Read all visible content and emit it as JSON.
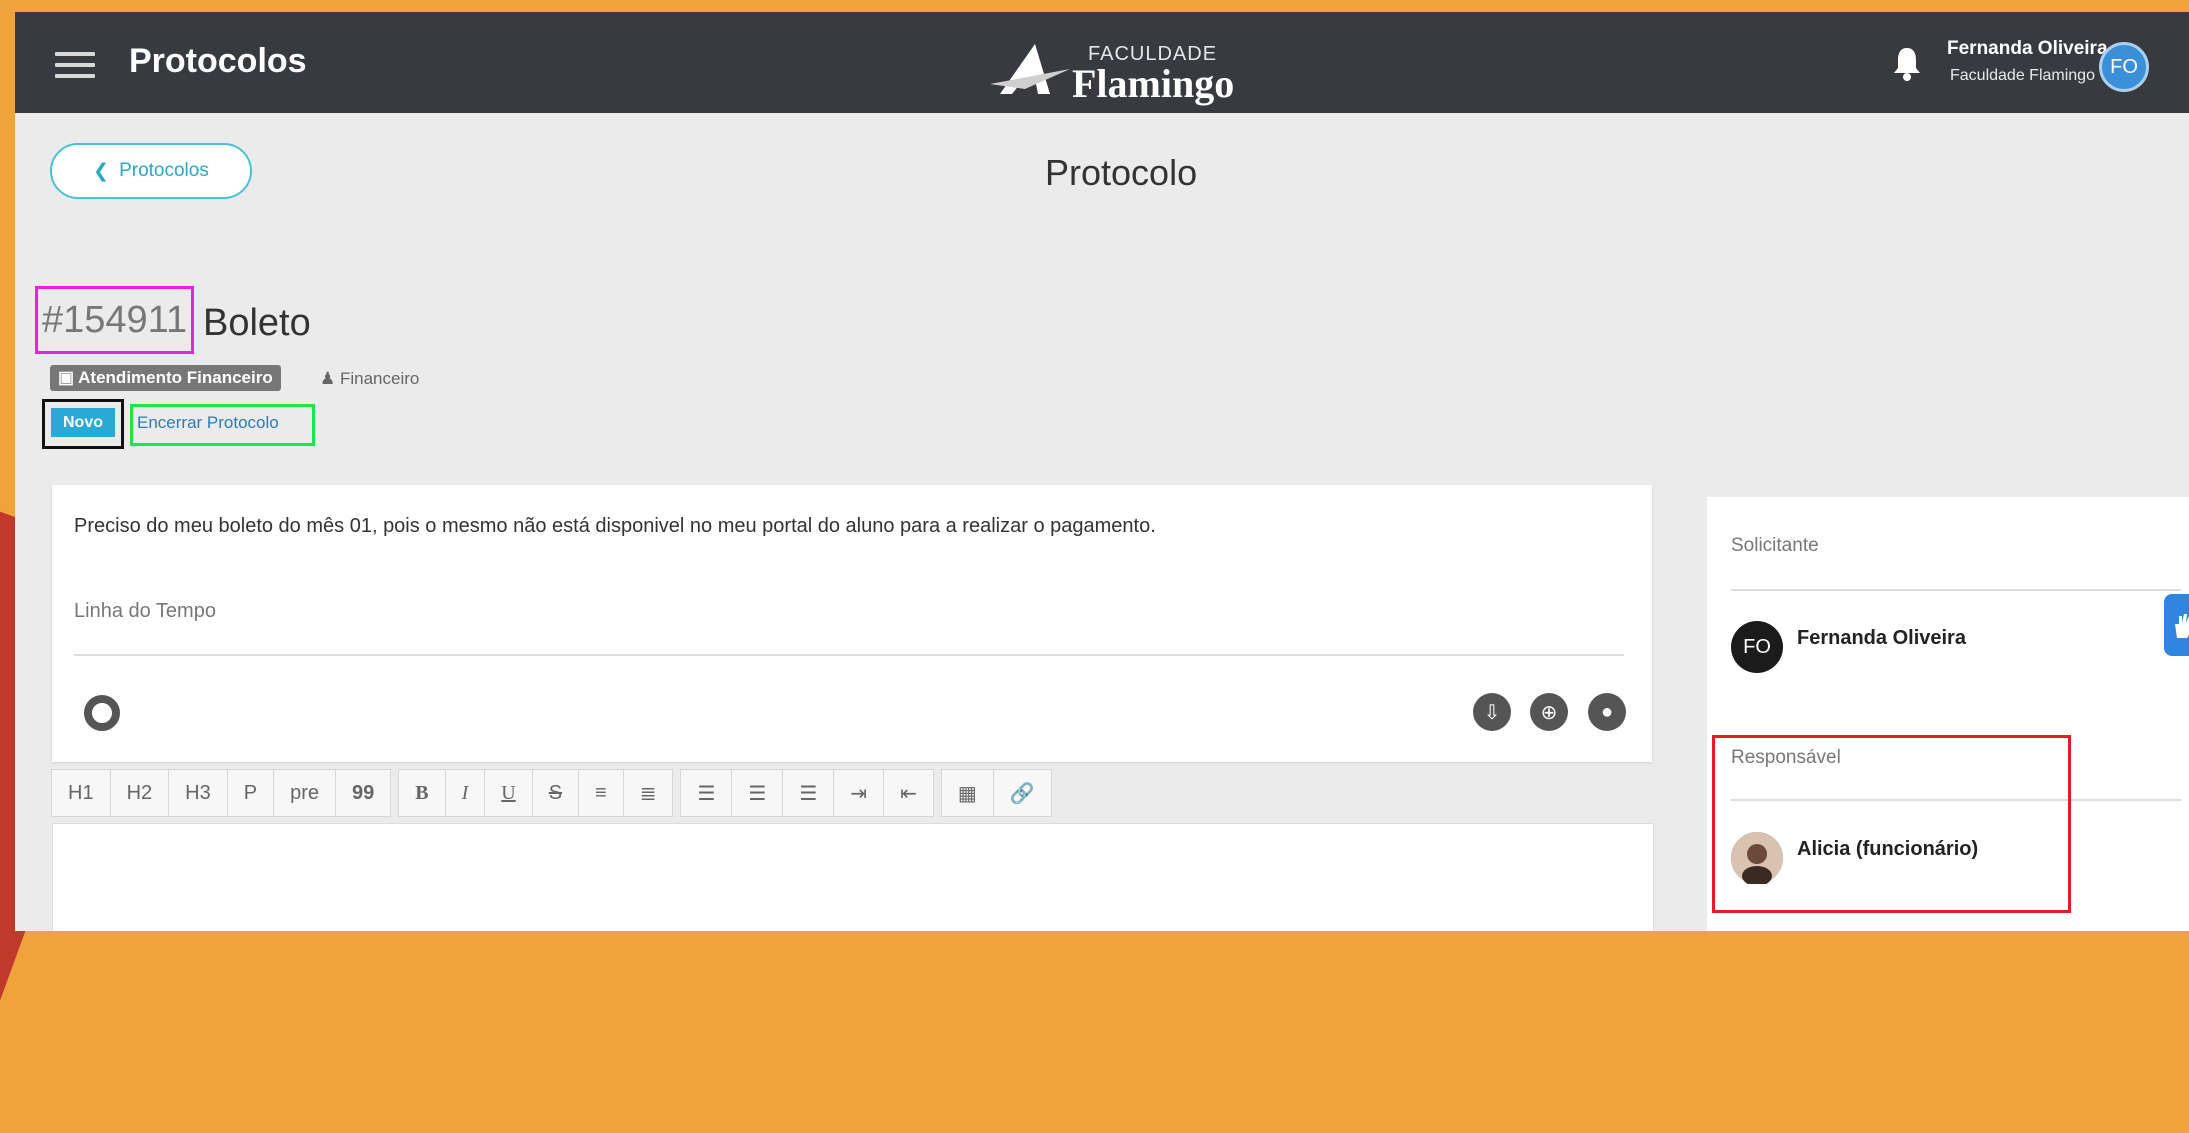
{
  "header": {
    "app_title": "Protocolos",
    "logo_small": "FACULDADE",
    "logo_big": "Flamingo",
    "user_name": "Fernanda Oliveira",
    "user_org": "Faculdade Flamingo",
    "user_initials": "FO"
  },
  "nav": {
    "back_label": "Protocolos",
    "page_title": "Protocolo"
  },
  "protocol": {
    "number": "#154911",
    "name": "Boleto",
    "category": "Atendimento Financeiro",
    "sector": "Financeiro",
    "status": "Novo",
    "close_action": "Encerrar Protocolo"
  },
  "main": {
    "description": "Preciso do meu boleto do mês 01, pois o mesmo não está disponivel no meu portal do aluno para a realizar o pagamento.",
    "timeline_label": "Linha do Tempo"
  },
  "toolbar": {
    "headings": [
      "H1",
      "H2",
      "H3",
      "P",
      "pre",
      "99"
    ],
    "format": [
      "B",
      "I",
      "U",
      "S"
    ]
  },
  "side": {
    "requester_label": "Solicitante",
    "requester_name": "Fernanda Oliveira",
    "requester_initials": "FO",
    "responsible_label": "Responsável",
    "responsible_name": "Alicia (funcionário)"
  },
  "colors": {
    "topbar": "#373b40",
    "accent": "#2ba9d6",
    "highlight_number": "#ea1ee4",
    "highlight_status": "#111111",
    "highlight_close": "#1ee647",
    "highlight_responsible": "#e51c23"
  }
}
